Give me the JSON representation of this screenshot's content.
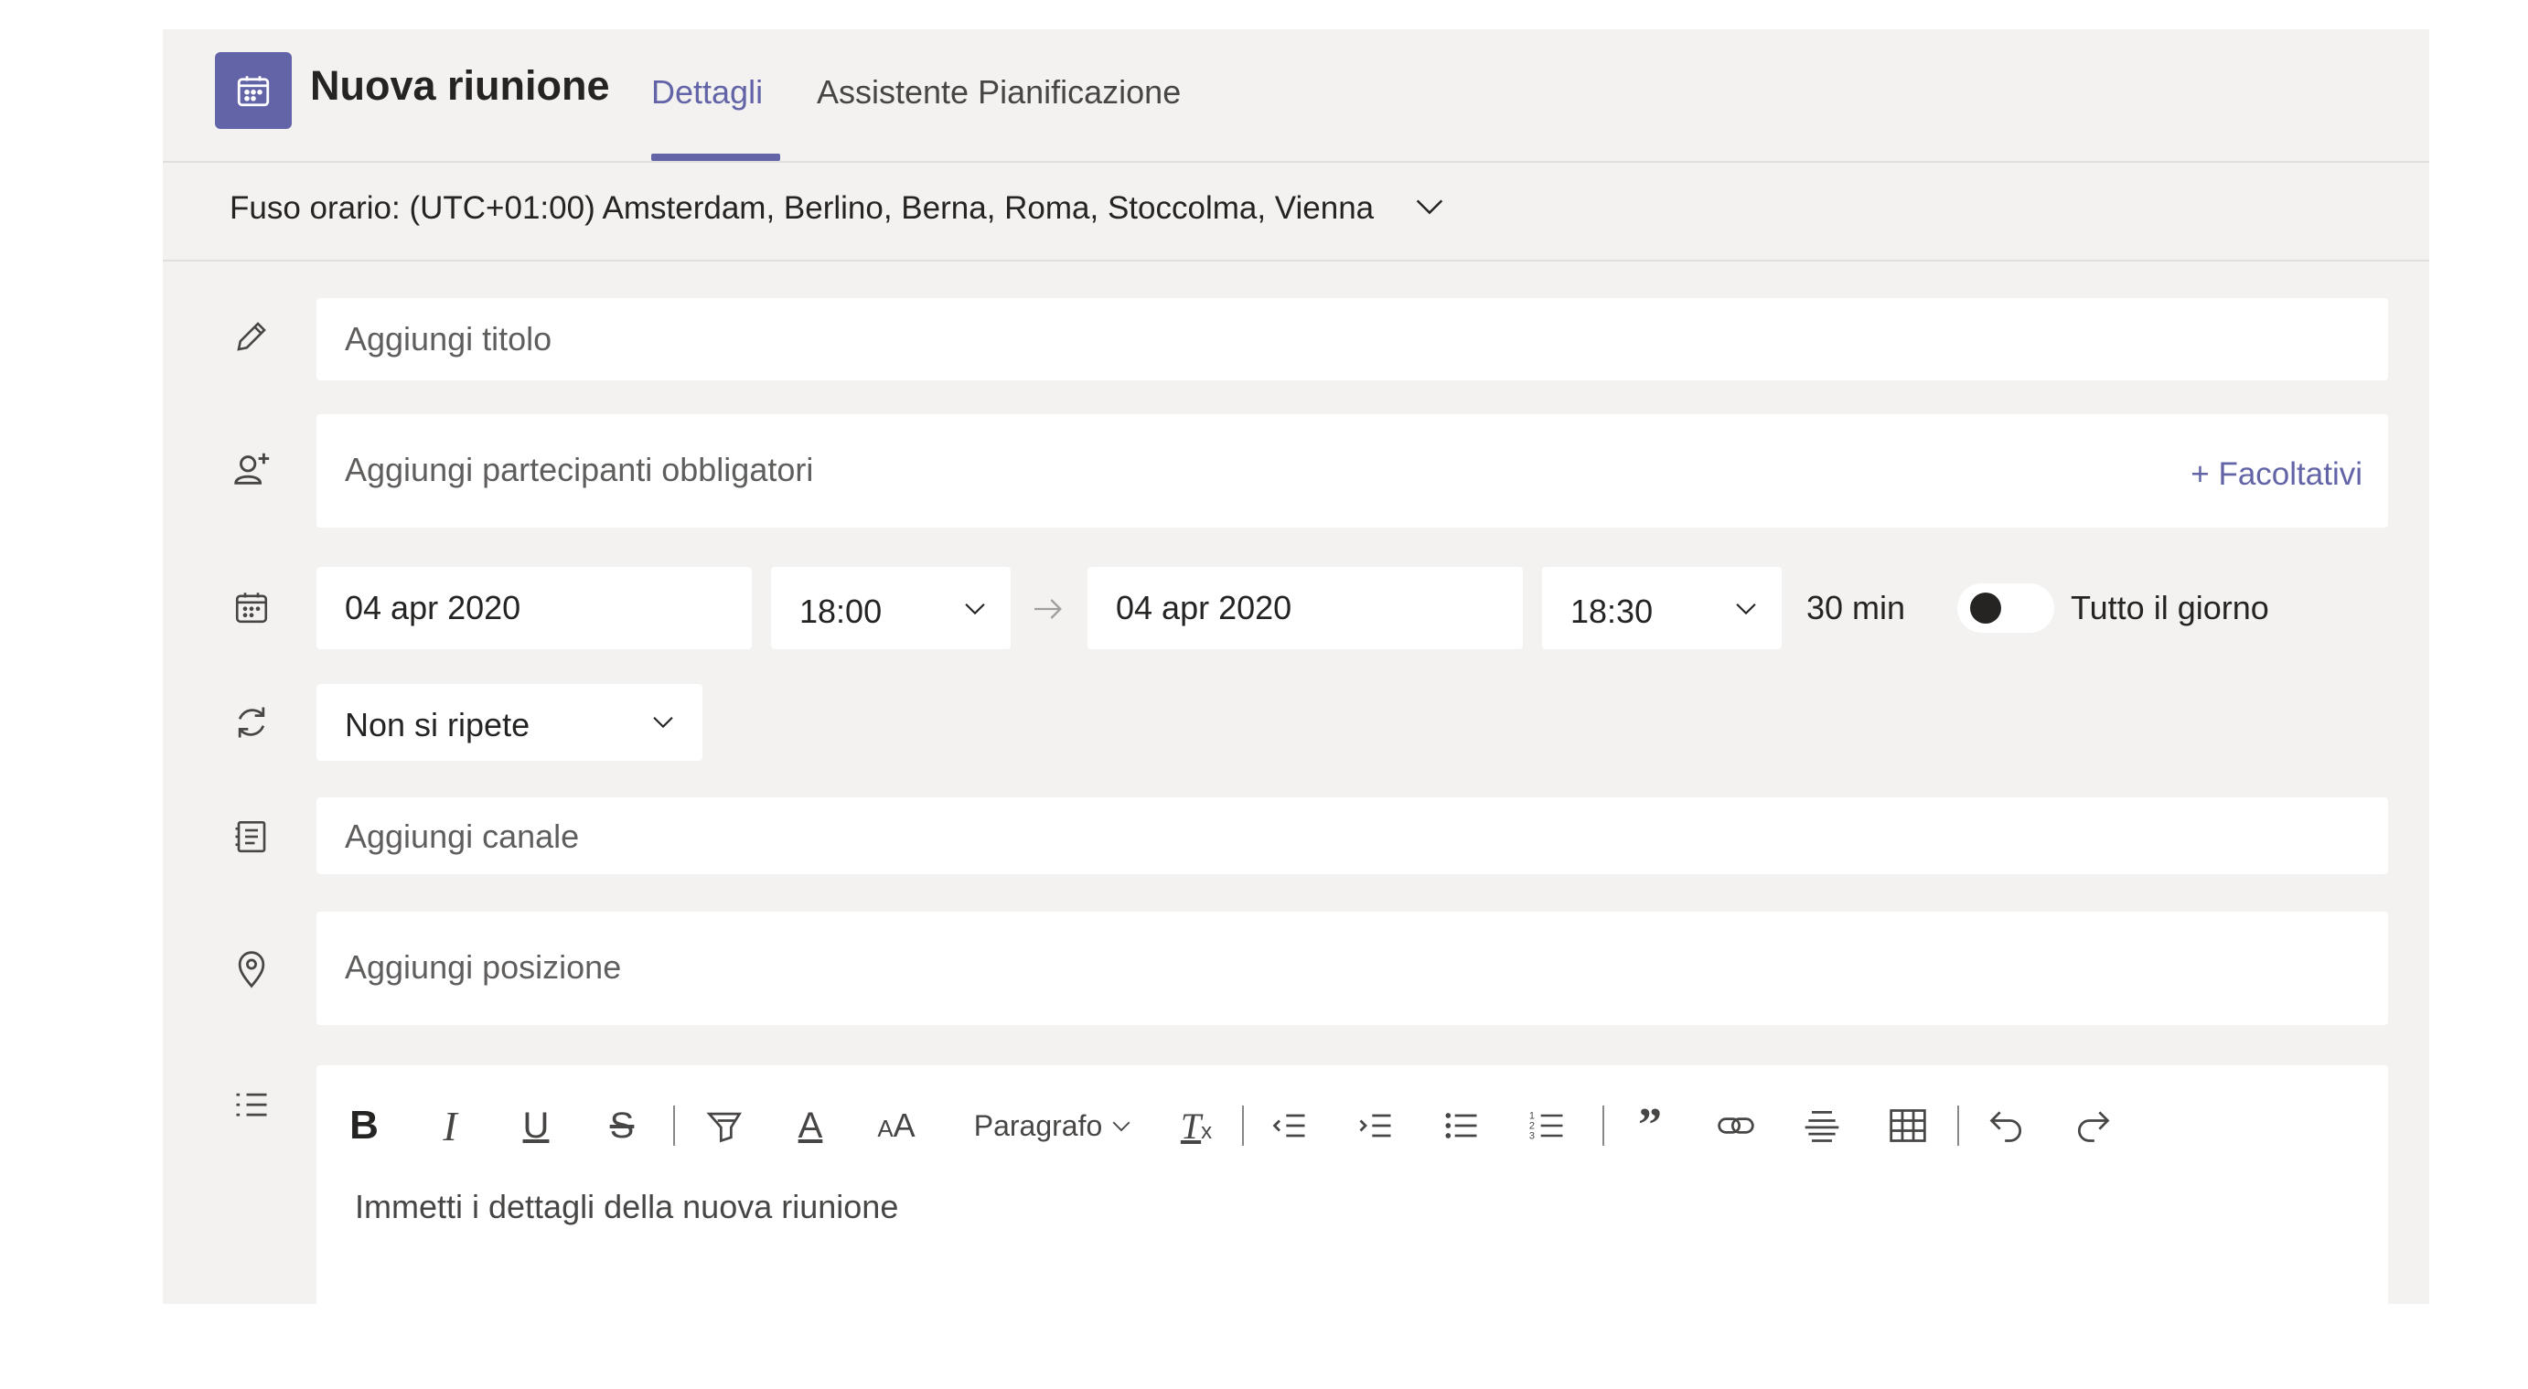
{
  "header": {
    "title": "Nuova riunione",
    "tabs": [
      {
        "label": "Dettagli",
        "active": true
      },
      {
        "label": "Assistente Pianificazione",
        "active": false
      }
    ],
    "accent_color": "#6264a7",
    "app_icon": "calendar-icon"
  },
  "timezone": {
    "label": "Fuso orario: (UTC+01:00) Amsterdam, Berlino, Berna, Roma, Stoccolma, Vienna"
  },
  "title_field": {
    "placeholder": "Aggiungi titolo",
    "icon": "pencil-icon"
  },
  "attendees": {
    "placeholder": "Aggiungi partecipanti obbligatori",
    "optional_link": "+ Facoltativi",
    "icon": "add-person-icon"
  },
  "schedule": {
    "start_date": "04 apr 2020",
    "start_time": "18:00",
    "end_date": "04 apr 2020",
    "end_time": "18:30",
    "duration": "30 min",
    "all_day_label": "Tutto il giorno",
    "all_day_on": false,
    "icon": "calendar-icon"
  },
  "recurrence": {
    "value": "Non si ripete",
    "icon": "repeat-icon"
  },
  "channel": {
    "placeholder": "Aggiungi canale",
    "icon": "channel-icon"
  },
  "location": {
    "placeholder": "Aggiungi posizione",
    "icon": "location-pin-icon"
  },
  "editor": {
    "placeholder": "Immetti i dettagli della nuova riunione",
    "paragraph_label": "Paragrafo",
    "icon": "details-list-icon",
    "toolbar": [
      "bold",
      "italic",
      "underline",
      "strikethrough",
      "highlight",
      "font-color",
      "font-size",
      "paragraph",
      "clear-formatting",
      "decrease-indent",
      "increase-indent",
      "bulleted-list",
      "numbered-list",
      "quote",
      "link",
      "horizontal-rule",
      "table",
      "undo",
      "redo"
    ]
  }
}
